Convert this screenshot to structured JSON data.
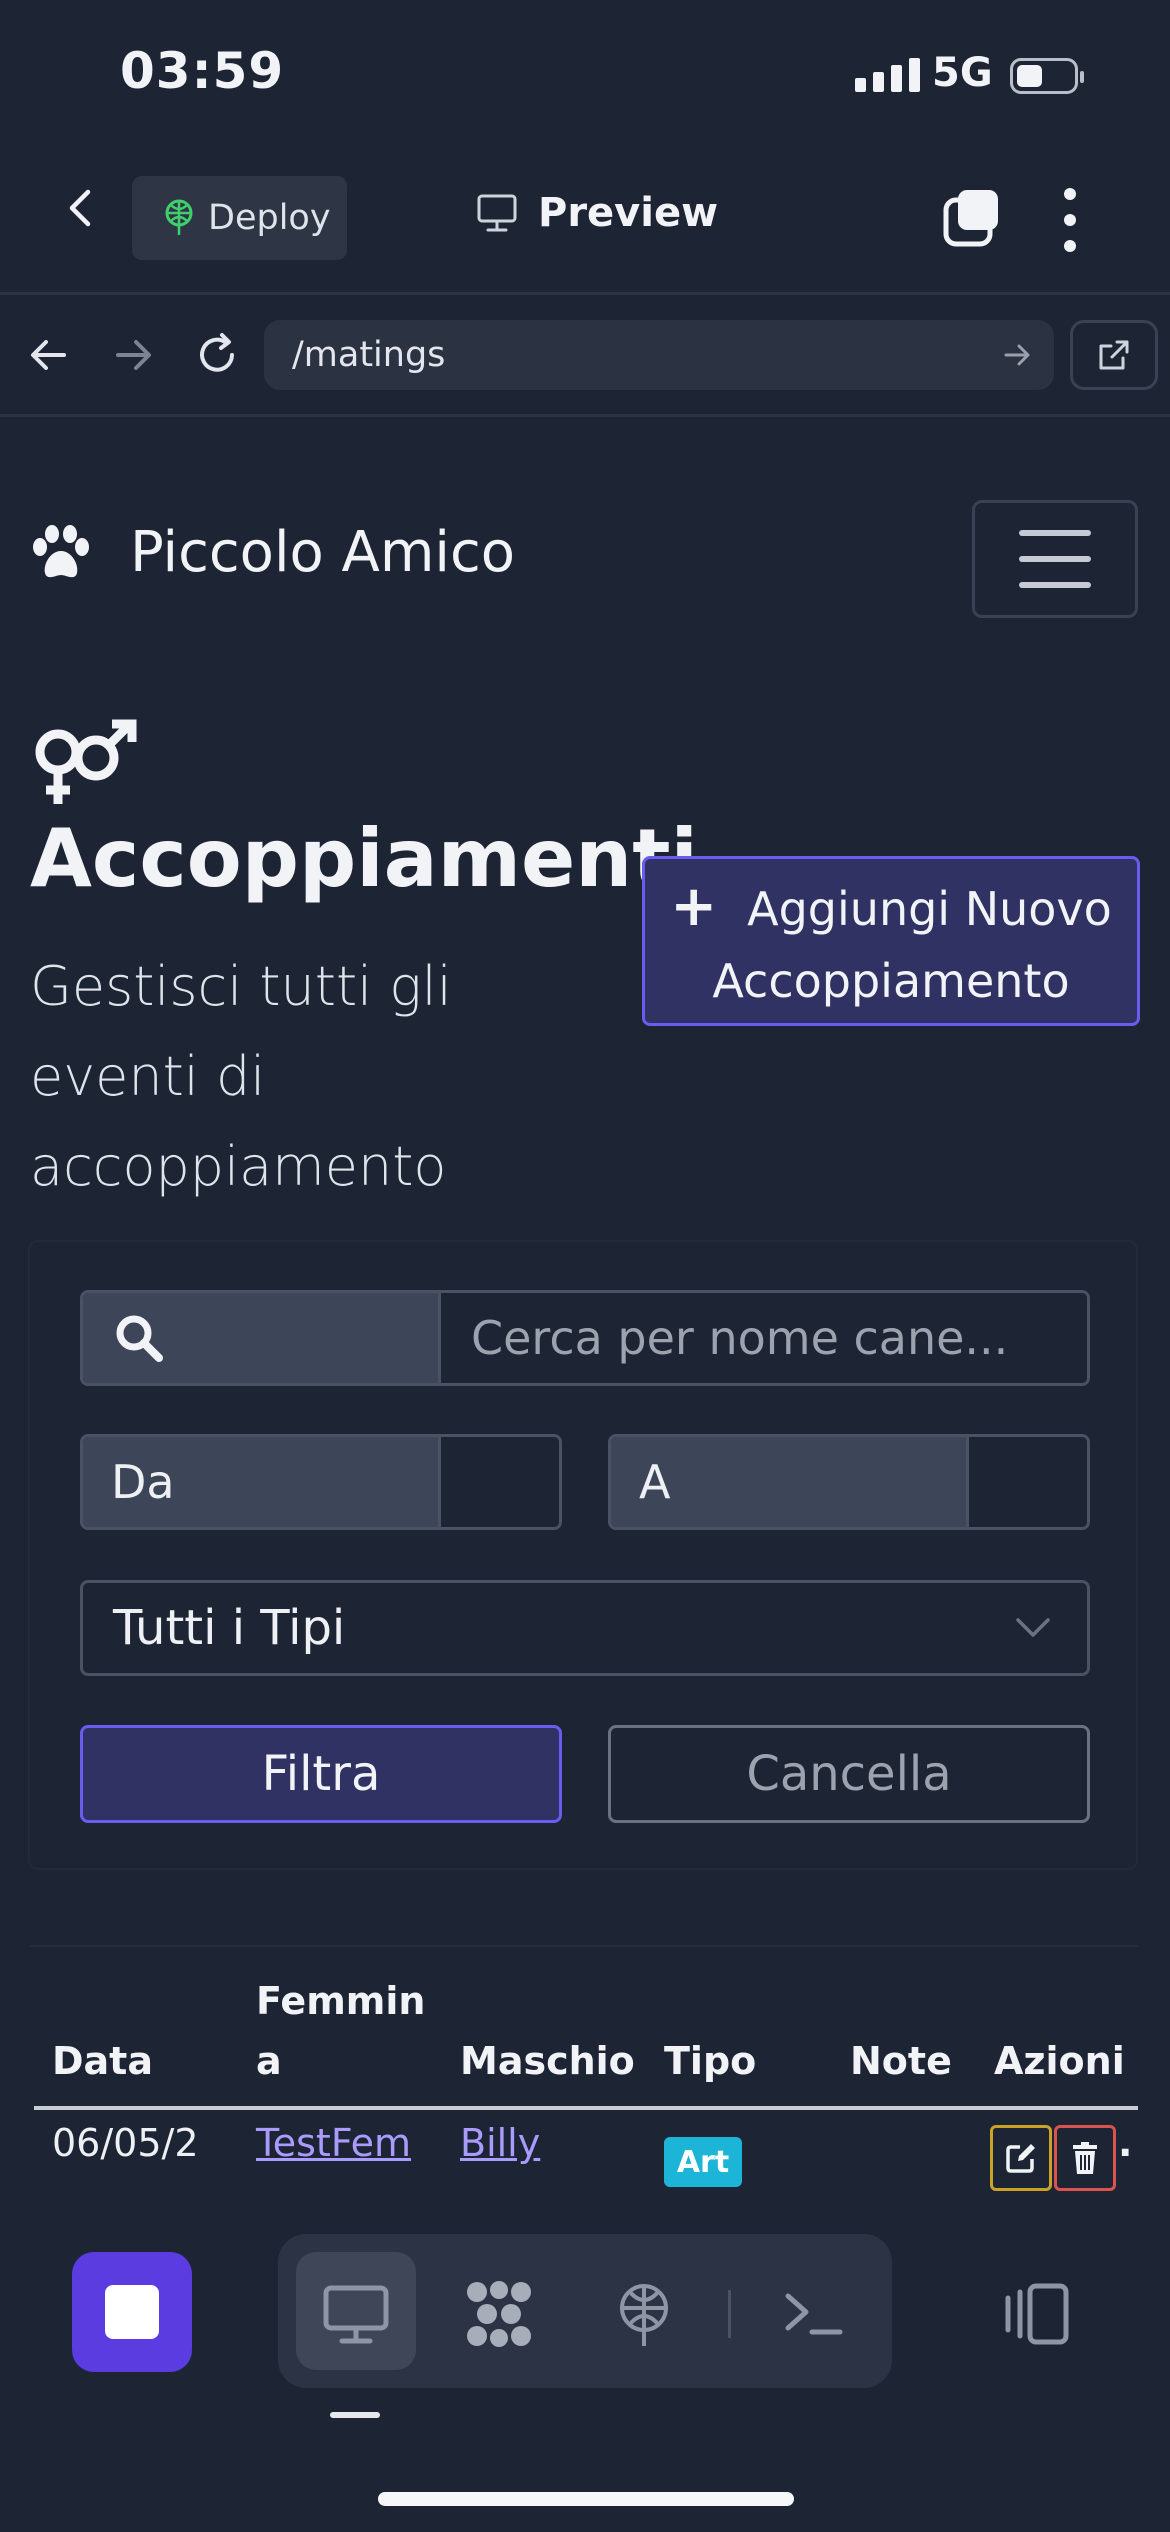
{
  "status_bar": {
    "time": "03:59",
    "network": "5G",
    "battery_level": 0.45
  },
  "app_bar": {
    "deploy_label": "Deploy",
    "preview_label": "Preview"
  },
  "browser": {
    "url": "/matings"
  },
  "site": {
    "brand": "Piccolo Amico",
    "title": "Accoppiamenti",
    "subtitle": "Gestisci tutti gli eventi di accoppiamento",
    "add_button": {
      "line1": "Aggiungi Nuovo",
      "line2": "Accoppiamento"
    }
  },
  "filters": {
    "search_placeholder": "Cerca per nome cane...",
    "from_label": "Da",
    "to_label": "A",
    "type_select": "Tutti i Tipi",
    "filter_button": "Filtra",
    "cancel_button": "Cancella"
  },
  "table": {
    "headers": {
      "data": "Data",
      "femmina_line1": "Femmin",
      "femmina_line2": "a",
      "maschio": "Maschio",
      "tipo": "Tipo",
      "note": "Note",
      "azioni": "Azioni"
    },
    "rows": [
      {
        "data": "06/05/2",
        "femmina": "TestFem",
        "maschio": "Billy",
        "tipo": "Art",
        "note": "",
        "overflow": "."
      }
    ]
  },
  "colors": {
    "background": "#1d2434",
    "accent": "#6b5cf0",
    "badge": "#1db5d7",
    "edit": "#c9a227",
    "delete": "#d9534f"
  },
  "icons": [
    "back-icon",
    "deploy-icon",
    "monitor-icon",
    "tabs-icon",
    "more-icon",
    "arrow-left-icon",
    "arrow-right-icon",
    "reload-icon",
    "go-icon",
    "external-link-icon",
    "paw-icon",
    "menu-icon",
    "gender-icon",
    "plus-icon",
    "search-icon",
    "chevron-down-icon",
    "edit-icon",
    "trash-icon",
    "stop-icon",
    "desktop-icon",
    "modules-icon",
    "deploy-dock-icon",
    "terminal-icon",
    "split-view-icon"
  ]
}
